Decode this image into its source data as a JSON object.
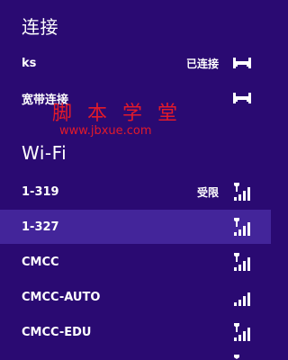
{
  "connections": {
    "title": "连接",
    "items": [
      {
        "name": "ks",
        "status": "已连接",
        "icon": "ethernet-icon"
      },
      {
        "name": "宽带连接",
        "status": "",
        "icon": "ethernet-icon"
      }
    ]
  },
  "wifi": {
    "title": "Wi-Fi",
    "networks": [
      {
        "name": "1-319",
        "status": "受限",
        "secured": true,
        "selected": false
      },
      {
        "name": "1-327",
        "status": "",
        "secured": true,
        "selected": true
      },
      {
        "name": "CMCC",
        "status": "",
        "secured": true,
        "selected": false
      },
      {
        "name": "CMCC-AUTO",
        "status": "",
        "secured": false,
        "selected": false
      },
      {
        "name": "CMCC-EDU",
        "status": "",
        "secured": true,
        "selected": false
      }
    ]
  },
  "watermark": {
    "text": "脚 本 学 堂",
    "url": "www.jbxue.com"
  },
  "colors": {
    "background": "#2a0a72",
    "selected_row": "#43259a",
    "watermark": "#e21a2a"
  }
}
